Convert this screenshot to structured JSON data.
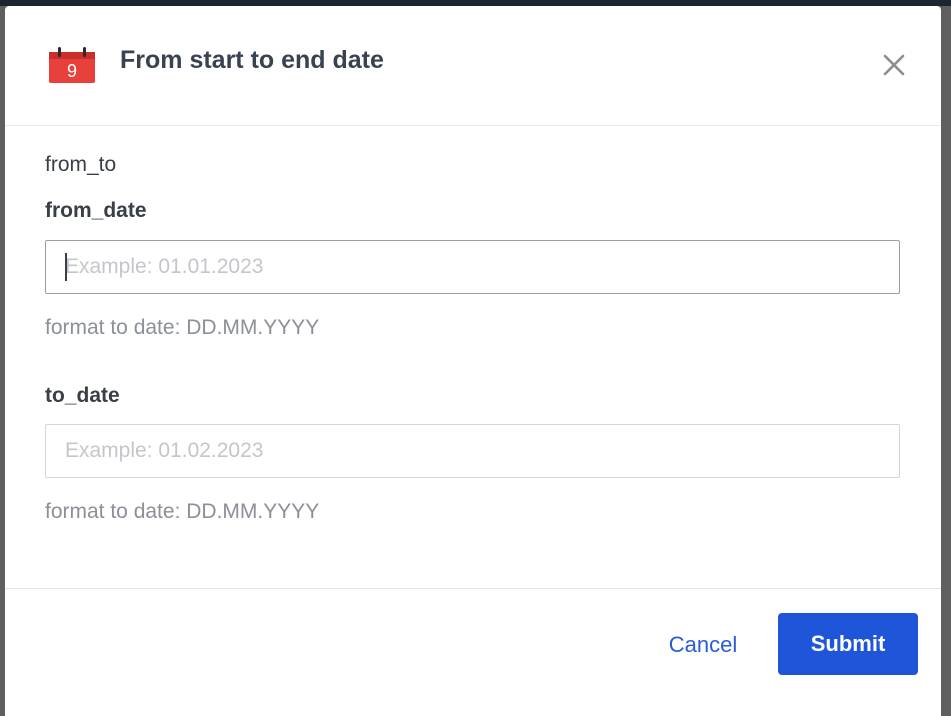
{
  "dialog": {
    "title": "From start to end date",
    "icon_day": "9",
    "icon": "calendar-icon",
    "close_icon": "close-icon"
  },
  "form": {
    "section_label": "from_to",
    "from_date": {
      "label": "from_date",
      "value": "",
      "placeholder": "Example: 01.01.2023",
      "help": "format to date: DD.MM.YYYY"
    },
    "to_date": {
      "label": "to_date",
      "value": "",
      "placeholder": "Example: 01.02.2023",
      "help": "format to date: DD.MM.YYYY"
    }
  },
  "footer": {
    "cancel_label": "Cancel",
    "submit_label": "Submit"
  },
  "colors": {
    "accent": "#1f56d9",
    "link": "#2a5bd7",
    "title_text": "#3a4150",
    "help_text": "#8c9097",
    "calendar_red": "#e8403a"
  }
}
